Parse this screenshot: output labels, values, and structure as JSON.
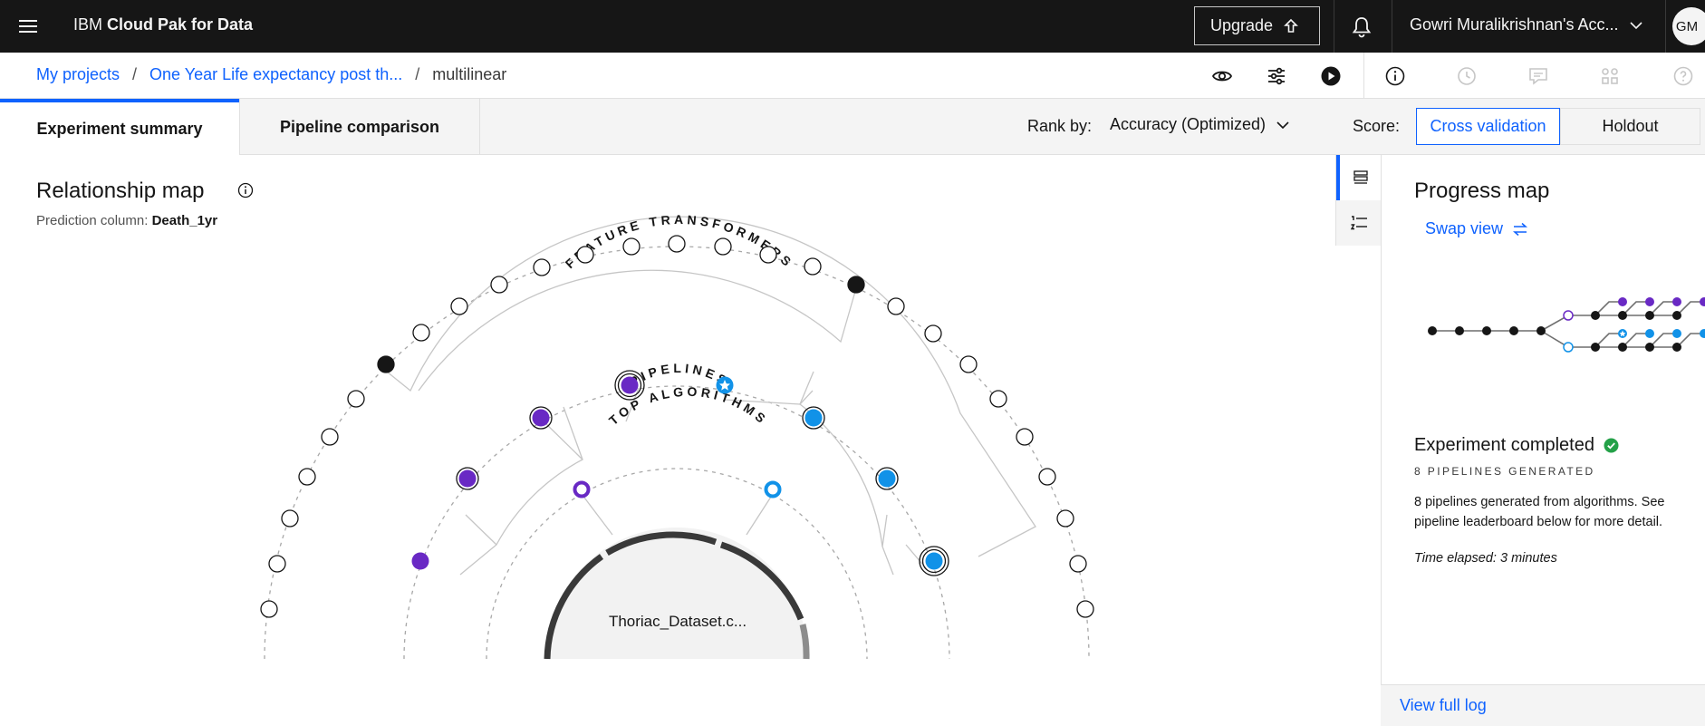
{
  "header": {
    "brand_prefix": "IBM ",
    "brand_bold": "Cloud Pak for Data",
    "upgrade_label": "Upgrade",
    "account_label": "Gowri Muralikrishnan's Acc...",
    "avatar_initials": "GM"
  },
  "breadcrumb": {
    "items": [
      "My projects",
      "One Year Life expectancy post th..."
    ],
    "current": "multilinear",
    "separator": "/"
  },
  "tabs": [
    {
      "label": "Experiment summary",
      "active": true
    },
    {
      "label": "Pipeline comparison",
      "active": false
    }
  ],
  "rank": {
    "label": "Rank by:",
    "value": "Accuracy (Optimized)"
  },
  "score": {
    "label": "Score:",
    "options": [
      "Cross validation",
      "Holdout"
    ],
    "selected": "Cross validation"
  },
  "relationship_map": {
    "title": "Relationship map",
    "prediction_label": "Prediction column: ",
    "prediction_value": "Death_1yr",
    "ring_labels": {
      "feature_transformers": "FEATURE TRANSFORMERS",
      "pipelines": "PIPELINES",
      "top_algorithms": "TOP ALGORITHMS"
    },
    "dataset_label": "Thoriac_Dataset.c..."
  },
  "progress_map": {
    "title": "Progress map",
    "swap_label": "Swap view",
    "status_title": "Experiment completed",
    "pipelines_generated": "8 PIPELINES GENERATED",
    "description": "8 pipelines generated from algorithms. See pipeline leaderboard below for more detail.",
    "elapsed": "Time elapsed: 3 minutes",
    "footer_link": "View full log"
  },
  "colors": {
    "purple": "#6929c4",
    "blue": "#1192e8",
    "accent": "#0f62fe",
    "success": "#24a148"
  }
}
